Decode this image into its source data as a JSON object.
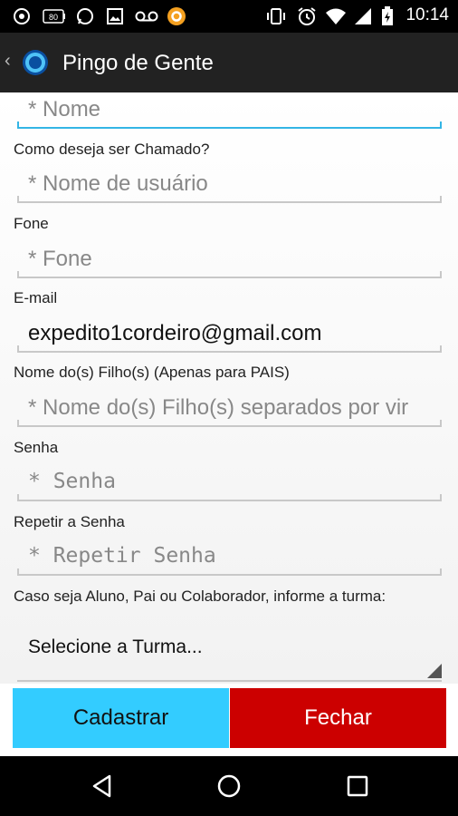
{
  "status_bar": {
    "time": "10:14",
    "icons": [
      "chrome-icon",
      "battery-80-icon",
      "whatsapp-icon",
      "image-icon",
      "voicemail-icon",
      "app-notification-icon",
      "vibrate-icon",
      "alarm-icon",
      "wifi-icon",
      "signal-icon",
      "battery-charging-icon"
    ],
    "battery_label": "80"
  },
  "action_bar": {
    "back_icon": "chevron-left-icon",
    "app_icon": "app-logo-icon",
    "title": "Pingo de Gente"
  },
  "form": {
    "nome": {
      "placeholder": "* Nome"
    },
    "apelido": {
      "label": "Como deseja ser Chamado?",
      "placeholder": "* Nome de usuário"
    },
    "fone": {
      "label": "Fone",
      "placeholder": "* Fone"
    },
    "email": {
      "label": "E-mail",
      "value": "expedito1cordeiro@gmail.com"
    },
    "filhos": {
      "label": "Nome do(s) Filho(s) (Apenas para PAIS)",
      "placeholder": "* Nome do(s) Filho(s) separados por vir"
    },
    "senha": {
      "label": "Senha",
      "placeholder": "* Senha"
    },
    "repetir_senha": {
      "label": "Repetir a Senha",
      "placeholder": "* Repetir Senha"
    },
    "turma": {
      "label": "Caso seja Aluno, Pai ou Colaborador, informe a turma:",
      "selected": "Selecione a Turma..."
    }
  },
  "buttons": {
    "cadastrar": "Cadastrar",
    "fechar": "Fechar"
  },
  "colors": {
    "accent": "#33b5e5",
    "cadastrar_bg": "#33ccff",
    "fechar_bg": "#cc0000",
    "action_bar_bg": "#222222"
  },
  "nav_bar": {
    "icons": [
      "back-triangle-icon",
      "home-circle-icon",
      "recents-square-icon"
    ]
  }
}
